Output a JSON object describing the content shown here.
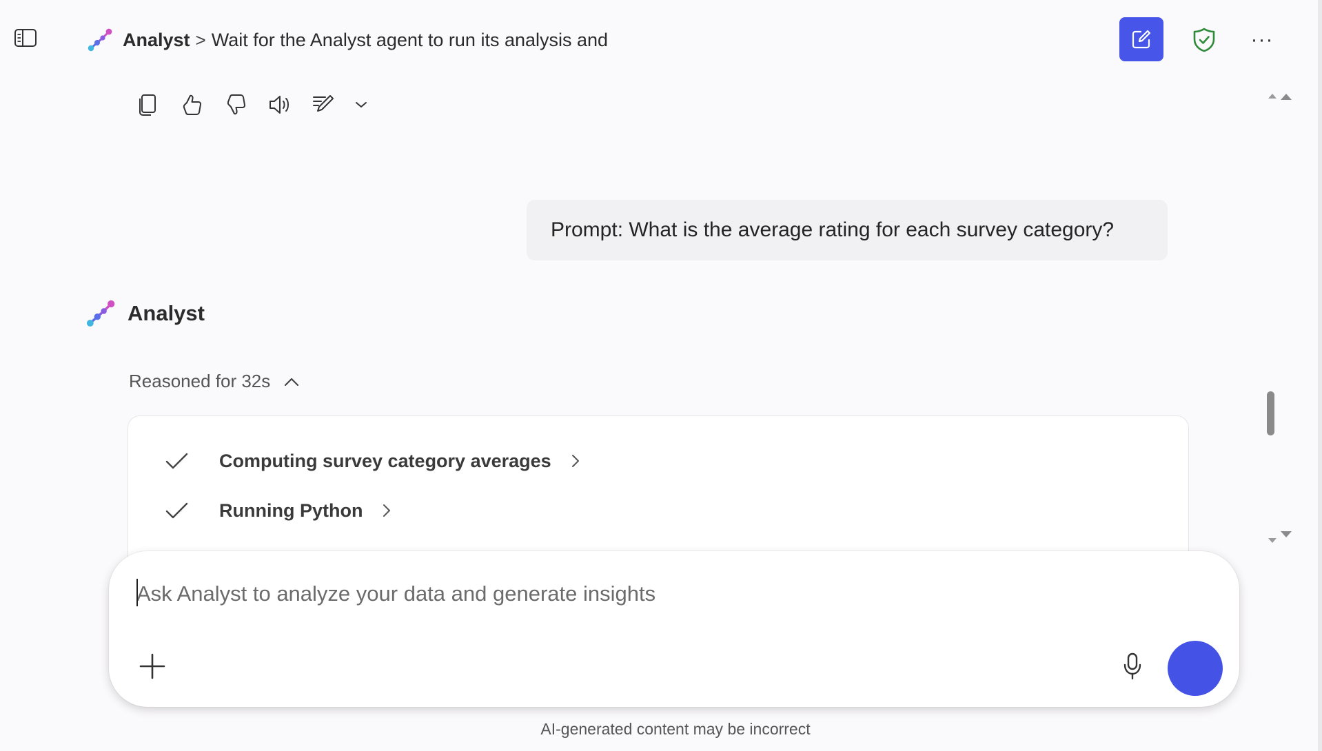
{
  "header": {
    "sidebar_toggle_icon": "sidebar-toggle-icon",
    "agent_name": "Analyst",
    "separator": ">",
    "conversation_title": "Wait for the Analyst agent to run its analysis and",
    "new_chat_icon": "compose-icon",
    "shield_icon": "shield-check-icon",
    "more_icon": "more-horizontal-icon",
    "more_label": "···"
  },
  "response_toolbar": {
    "icons": [
      "copy-icon",
      "thumbs-up-icon",
      "thumbs-down-icon",
      "speaker-icon",
      "edit-icon",
      "chevron-down-icon"
    ]
  },
  "conversation": {
    "user_prompt": "Prompt: What is the average rating for each survey category?",
    "agent_name": "Analyst",
    "reasoning_label": "Reasoned for 32s",
    "steps": [
      {
        "label": "Computing survey category averages",
        "status": "done"
      },
      {
        "label": "Running Python",
        "status": "done"
      }
    ]
  },
  "composer": {
    "placeholder": "Ask Analyst to analyze your data and generate insights",
    "value": ""
  },
  "footer": {
    "disclaimer": "AI-generated content may be incorrect"
  },
  "colors": {
    "accent": "#4756e8",
    "send": "#4452e6",
    "shield": "#2e8b3a",
    "background": "#faf9fb",
    "bubble": "#f1f1f3"
  }
}
